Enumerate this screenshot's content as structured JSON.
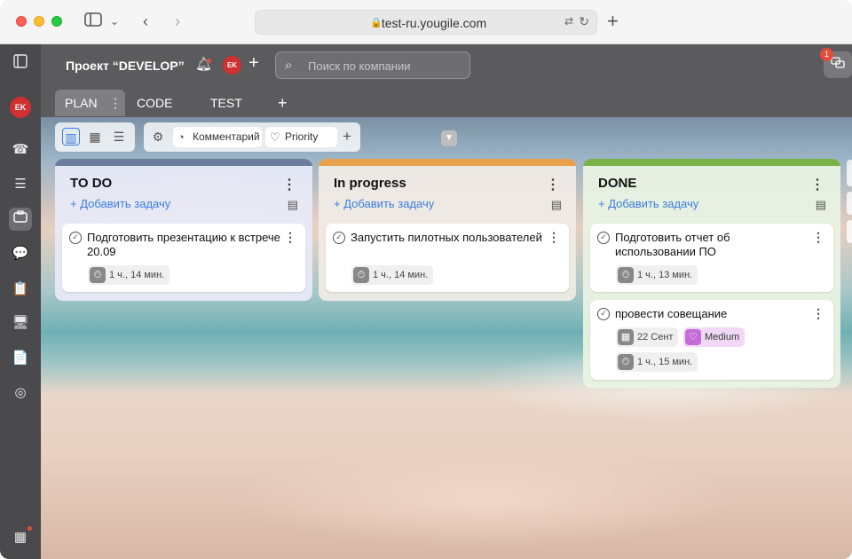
{
  "browser": {
    "url": "test-ru.yougile.com"
  },
  "topbar": {
    "project_title": "Проект “DEVELOP”",
    "avatar_initials": "EK",
    "search_placeholder": "Поиск по компании",
    "chat_badge": "1"
  },
  "sidebar": {
    "avatar_initials": "EK"
  },
  "tabs": [
    {
      "label": "PLAN",
      "active": true
    },
    {
      "label": "CODE",
      "active": false
    },
    {
      "label": "TEST",
      "active": false
    }
  ],
  "toolbar": {
    "comment_label": "Комментарий",
    "priority_label": "Priority"
  },
  "columns": [
    {
      "title": "TO DO",
      "color": "#6a7f9e",
      "add_task": "Добавить задачу",
      "cards": [
        {
          "title": "Подготовить презентацию к встрече 20.09",
          "timer": "1 ч., 14 мин."
        }
      ]
    },
    {
      "title": "In progress",
      "color": "#e8a049",
      "add_task": "Добавить задачу",
      "cards": [
        {
          "title": "Запустить пилотных пользователей",
          "timer": "1 ч., 14 мин."
        }
      ]
    },
    {
      "title": "DONE",
      "color": "#7ab24a",
      "add_task": "Добавить задачу",
      "cards": [
        {
          "title": "Подготовить отчет об использовании ПО",
          "timer": "1 ч., 13 мин."
        },
        {
          "title": "провести совещание",
          "date": "22 Сент",
          "priority": "Medium",
          "timer": "1 ч., 15 мин."
        }
      ]
    }
  ]
}
